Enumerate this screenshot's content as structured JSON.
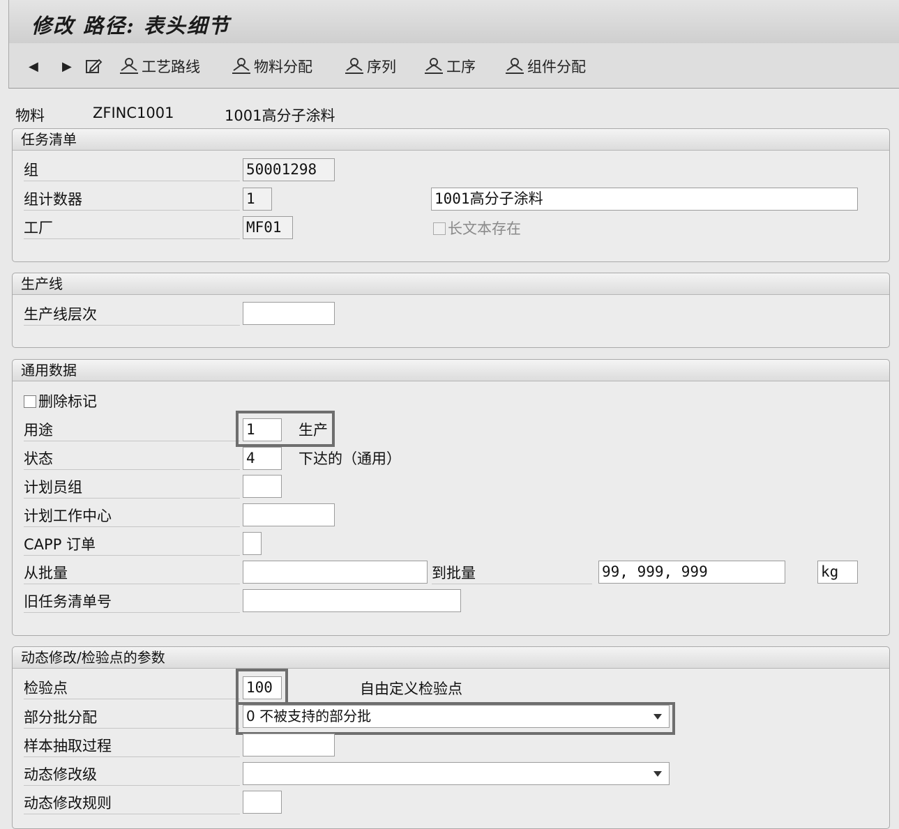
{
  "title": "修改 路径:  表头细节",
  "toolbar": {
    "back_label": "◀",
    "forward_label": "▶",
    "items": [
      "工艺路线",
      "物料分配",
      "序列",
      "工序",
      "组件分配"
    ]
  },
  "material": {
    "label": "物料",
    "code": "ZFINC1001",
    "description": "1001高分子涂料"
  },
  "task_list": {
    "header": "任务清单",
    "group_label": "组",
    "group_value": "50001298",
    "group_counter_label": "组计数器",
    "group_counter_value": "1",
    "description_value": "1001高分子涂料",
    "plant_label": "工厂",
    "plant_value": "MF01",
    "long_text_label": "长文本存在"
  },
  "production_line": {
    "header": "生产线",
    "hierarchy_label": "生产线层次",
    "hierarchy_value": ""
  },
  "general_data": {
    "header": "通用数据",
    "deletion_flag_label": "删除标记",
    "usage_label": "用途",
    "usage_value": "1",
    "usage_text": "生产",
    "status_label": "状态",
    "status_value": "4",
    "status_text": "下达的（通用）",
    "planner_group_label": "计划员组",
    "planner_group_value": "",
    "planning_wc_label": "计划工作中心",
    "planning_wc_value": "",
    "capp_label": "CAPP 订单",
    "capp_value": "",
    "from_lot_label": "从批量",
    "from_lot_value": "",
    "to_lot_label": "到批量",
    "to_lot_value": "99, 999, 999",
    "unit_value": "kg",
    "old_task_label": "旧任务清单号",
    "old_task_value": ""
  },
  "dynamic_mod": {
    "header": "动态修改/检验点的参数",
    "inspection_point_label": "检验点",
    "inspection_point_value": "100",
    "inspection_point_text": "自由定义检验点",
    "partial_lot_label": "部分批分配",
    "partial_lot_value": "0 不被支持的部分批",
    "sample_proc_label": "样本抽取过程",
    "sample_proc_value": "",
    "dyn_level_label": "动态修改级",
    "dyn_level_value": "",
    "dyn_rule_label": "动态修改规则",
    "dyn_rule_value": ""
  }
}
